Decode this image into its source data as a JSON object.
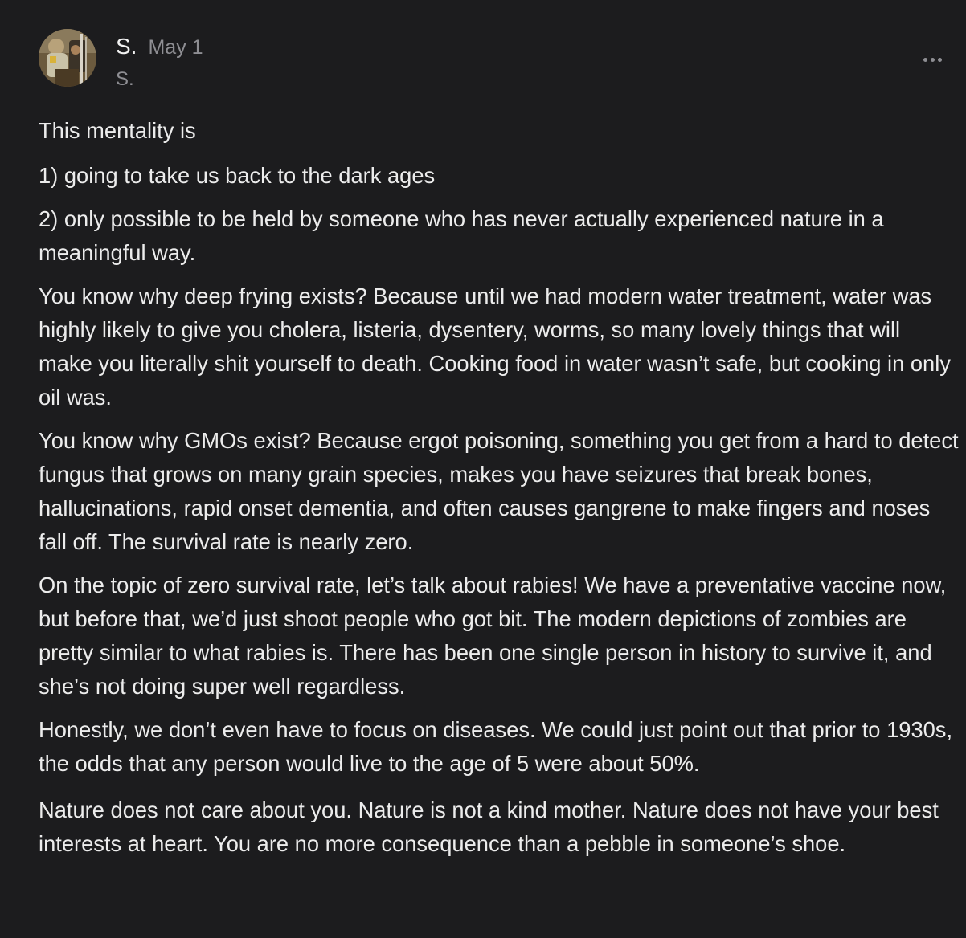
{
  "post": {
    "author": "S.",
    "date": "May 1",
    "handle": "S.",
    "avatar": "author-avatar-photo",
    "more_icon": "more-horizontal-icon",
    "paragraphs": [
      "This mentality is",
      "1) going to take us back to the dark ages",
      "2) only possible to be held by someone who has never actually experienced nature in a meaningful way.",
      "You know why deep frying exists? Because until we had modern water treatment, water was highly likely to give you cholera, listeria, dysentery, worms, so many lovely things that will make you literally shit yourself to death. Cooking food in water wasn’t safe, but cooking in only oil was.",
      "You know why GMOs exist? Because ergot poisoning, something you get from a hard to detect fungus that grows on many grain species, makes you have seizures that break bones, hallucinations, rapid onset dementia, and often causes gangrene to make fingers and noses fall off. The survival rate is nearly zero.",
      "On the topic of zero survival rate, let’s talk about rabies! We have a preventative vaccine now, but before that, we’d just shoot people who got bit. The modern depictions of zombies are pretty similar to what rabies is. There has been one single person in history to survive it, and she’s not doing super well regardless.",
      "Honestly, we don’t even have to focus on diseases. We could just point out that prior to 1930s, the odds that any person would live to the age of 5 were about 50%.",
      "Nature does not care about you. Nature is not a kind mother. Nature does not have your best interests at heart. You are no more consequence than a pebble in someone’s shoe."
    ]
  },
  "colors": {
    "background": "#1c1c1e",
    "text_primary": "#ececec",
    "text_secondary": "#8e8e93"
  }
}
